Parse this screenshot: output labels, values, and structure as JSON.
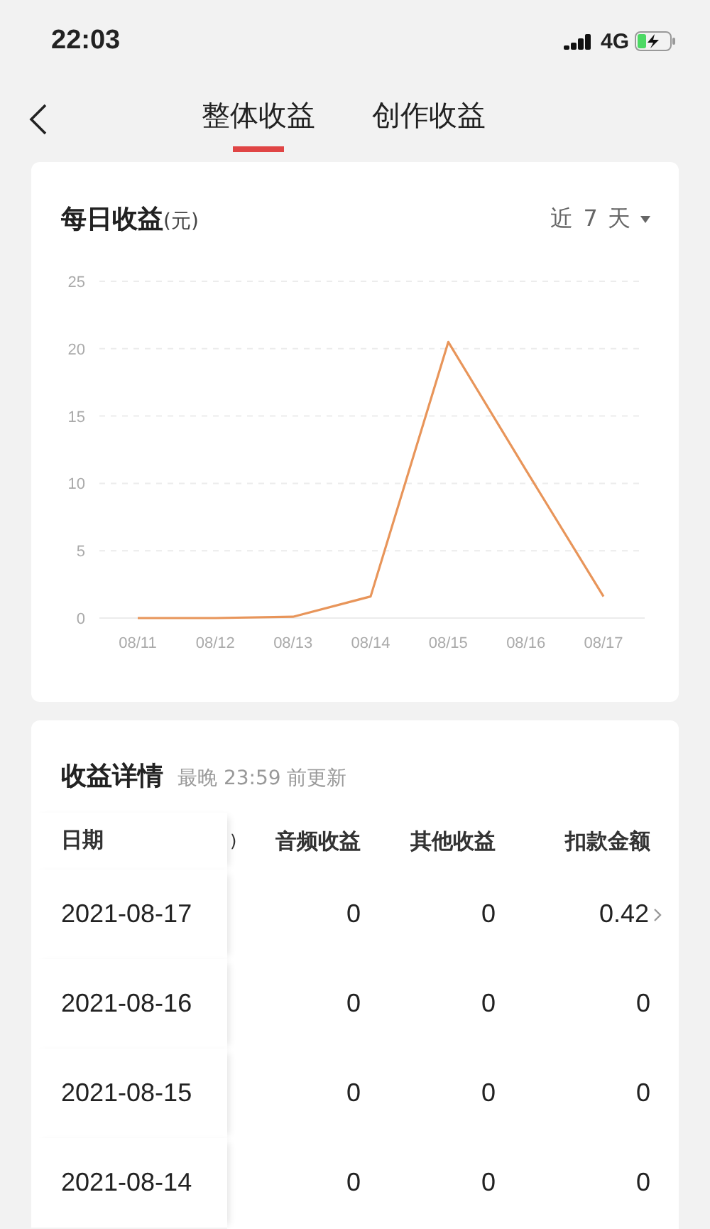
{
  "status_bar": {
    "time": "22:03",
    "network": "4G",
    "charging": true
  },
  "nav": {
    "tabs": [
      {
        "label": "整体收益",
        "selected": true
      },
      {
        "label": "创作收益",
        "selected": false
      }
    ]
  },
  "daily_card": {
    "title": "每日收益",
    "unit": "(元)",
    "range": "近 7 天",
    "chart_data": {
      "type": "line",
      "categories": [
        "08/11",
        "08/12",
        "08/13",
        "08/14",
        "08/15",
        "08/16",
        "08/17"
      ],
      "grid": true,
      "series": [
        {
          "color": "#e8955a",
          "values": [
            0,
            0,
            0.1,
            1.6,
            20.5,
            11,
            1.6
          ]
        }
      ],
      "ylim": [
        0,
        25
      ],
      "yticks": [
        0,
        5,
        10,
        15,
        20,
        25
      ]
    }
  },
  "details": {
    "title": "收益详情",
    "note": "最晚 23:59 前更新",
    "columns": [
      "日期",
      ")",
      "音频收益",
      "其他收益",
      "扣款金额"
    ],
    "rows": [
      {
        "cells": [
          "2021-08-17",
          "",
          "0",
          "0",
          "0.42"
        ],
        "has_detail": true
      },
      {
        "cells": [
          "2021-08-16",
          "",
          "0",
          "0",
          "0"
        ],
        "has_detail": false
      },
      {
        "cells": [
          "2021-08-15",
          "",
          "0",
          "0",
          "0"
        ],
        "has_detail": false
      },
      {
        "cells": [
          "2021-08-14",
          "",
          "0",
          "0",
          "0"
        ],
        "has_detail": false
      }
    ]
  }
}
